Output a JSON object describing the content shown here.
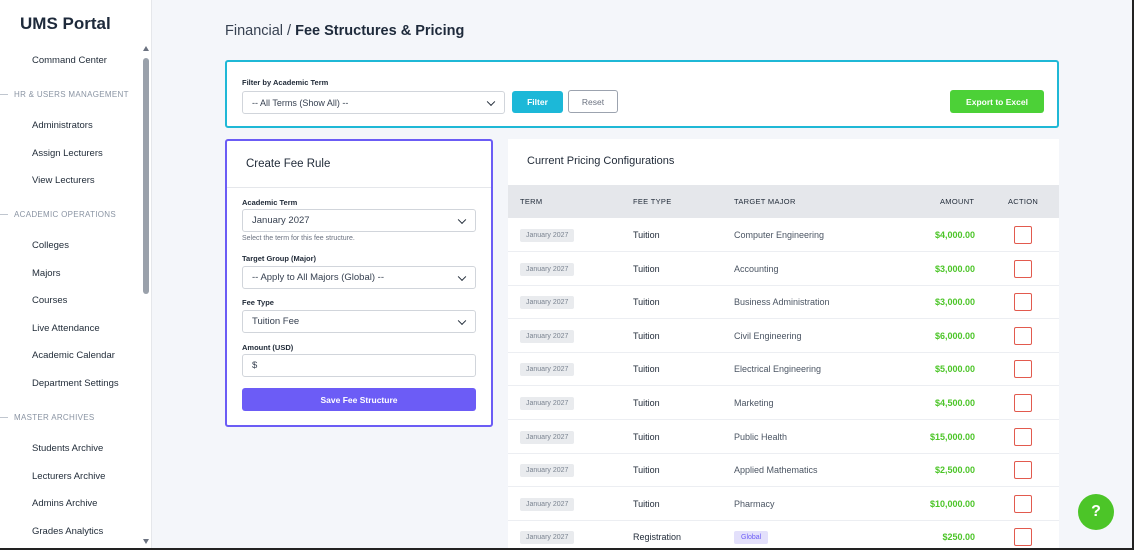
{
  "sidebar": {
    "brand": "UMS Portal",
    "items": [
      {
        "type": "link",
        "label": "Command Center"
      },
      {
        "type": "section",
        "label": "HR & USERS MANAGEMENT"
      },
      {
        "type": "link",
        "label": "Administrators"
      },
      {
        "type": "link",
        "label": "Assign Lecturers"
      },
      {
        "type": "link",
        "label": "View Lecturers"
      },
      {
        "type": "section",
        "label": "ACADEMIC OPERATIONS"
      },
      {
        "type": "link",
        "label": "Colleges"
      },
      {
        "type": "link",
        "label": "Majors"
      },
      {
        "type": "link",
        "label": "Courses"
      },
      {
        "type": "link",
        "label": "Live Attendance"
      },
      {
        "type": "link",
        "label": "Academic Calendar"
      },
      {
        "type": "link",
        "label": "Department Settings"
      },
      {
        "type": "section",
        "label": "MASTER ARCHIVES"
      },
      {
        "type": "link",
        "label": "Students Archive"
      },
      {
        "type": "link",
        "label": "Lecturers Archive"
      },
      {
        "type": "link",
        "label": "Admins Archive"
      },
      {
        "type": "link",
        "label": "Grades Analytics"
      }
    ]
  },
  "breadcrumb": {
    "parent": "Financial",
    "separator": " / ",
    "current": "Fee Structures & Pricing"
  },
  "filter": {
    "label": "Filter by Academic Term",
    "selected": "-- All Terms (Show All) --",
    "filter_button": "Filter",
    "reset_button": "Reset",
    "export_button": "Export to Excel"
  },
  "form": {
    "title": "Create Fee Rule",
    "term_label": "Academic Term",
    "term_value": "January 2027",
    "term_help": "Select the term for this fee structure.",
    "target_label": "Target Group (Major)",
    "target_value": "-- Apply to All Majors (Global) --",
    "fee_type_label": "Fee Type",
    "fee_type_value": "Tuition Fee",
    "amount_label": "Amount (USD)",
    "amount_prefix": "$",
    "save_button": "Save Fee Structure"
  },
  "table": {
    "title": "Current Pricing Configurations",
    "columns": [
      "TERM",
      "FEE TYPE",
      "TARGET MAJOR",
      "AMOUNT",
      "ACTION"
    ],
    "rows": [
      {
        "term": "January 2027",
        "fee_type": "Tuition",
        "major": "Computer Engineering",
        "amount": "$4,000.00"
      },
      {
        "term": "January 2027",
        "fee_type": "Tuition",
        "major": "Accounting",
        "amount": "$3,000.00"
      },
      {
        "term": "January 2027",
        "fee_type": "Tuition",
        "major": "Business Administration",
        "amount": "$3,000.00"
      },
      {
        "term": "January 2027",
        "fee_type": "Tuition",
        "major": "Civil Engineering",
        "amount": "$6,000.00"
      },
      {
        "term": "January 2027",
        "fee_type": "Tuition",
        "major": "Electrical Engineering",
        "amount": "$5,000.00"
      },
      {
        "term": "January 2027",
        "fee_type": "Tuition",
        "major": "Marketing",
        "amount": "$4,500.00"
      },
      {
        "term": "January 2027",
        "fee_type": "Tuition",
        "major": "Public Health",
        "amount": "$15,000.00"
      },
      {
        "term": "January 2027",
        "fee_type": "Tuition",
        "major": "Applied Mathematics",
        "amount": "$2,500.00"
      },
      {
        "term": "January 2027",
        "fee_type": "Tuition",
        "major": "Pharmacy",
        "amount": "$10,000.00"
      },
      {
        "term": "January 2027",
        "fee_type": "Registration",
        "major": "Global",
        "major_badge": true,
        "amount": "$250.00"
      }
    ]
  },
  "help_button": "?",
  "colors": {
    "accent_cyan": "#1cb8d8",
    "accent_purple": "#6c5cf6",
    "success_green": "#4cc528",
    "danger_red": "#e25a4e"
  }
}
